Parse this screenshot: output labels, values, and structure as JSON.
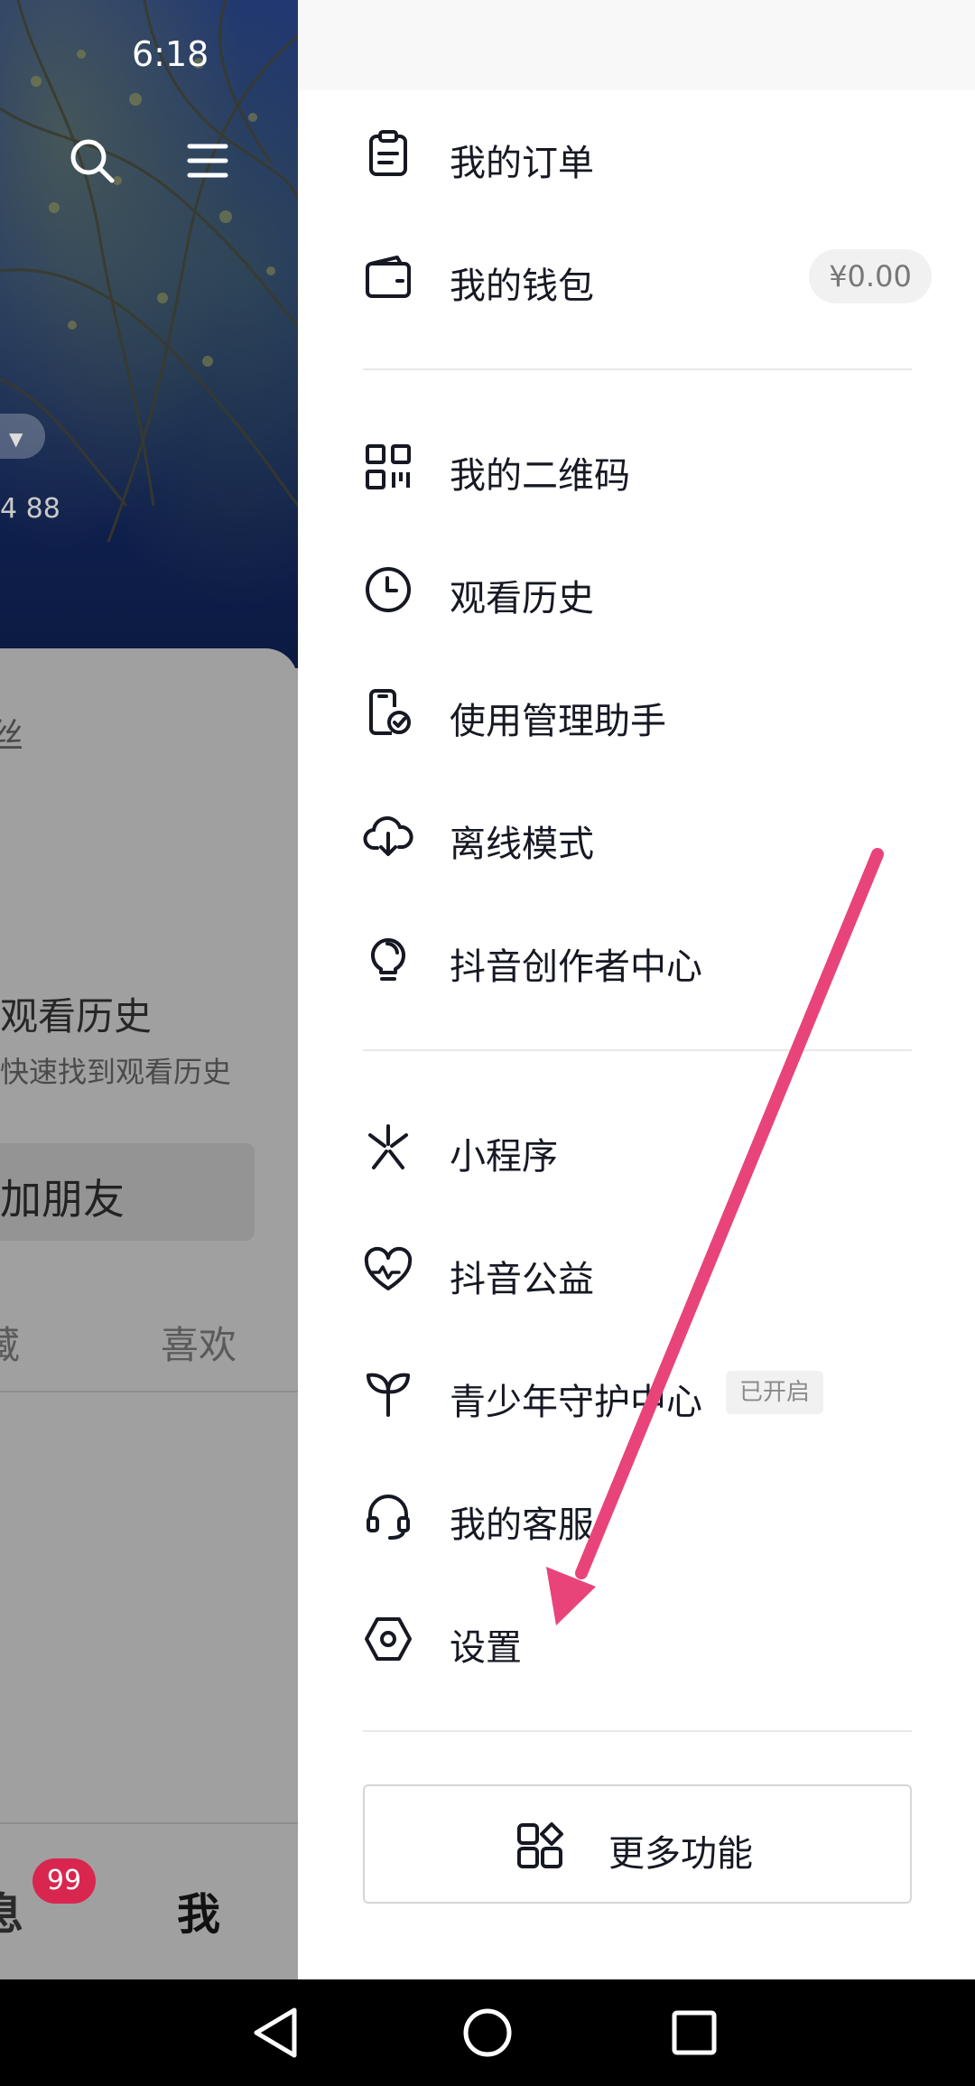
{
  "status_bar": {
    "time": "6:18"
  },
  "profile": {
    "stat_fragment": "4 88",
    "fans_fragment": "丝",
    "history_title": "观看历史",
    "history_subtitle": "快速找到观看历史",
    "add_friend_label": "加朋友",
    "tabs": {
      "collect": "藏",
      "like": "喜欢"
    },
    "bottom_nav": {
      "messages": "息",
      "messages_badge": "99",
      "me": "我"
    }
  },
  "drawer": {
    "menu": [
      {
        "label": "我的订单",
        "icon": "clipboard-icon"
      },
      {
        "label": "我的钱包",
        "icon": "wallet-icon",
        "badge": "¥0.00"
      },
      {
        "label": "我的二维码",
        "icon": "qr-code-icon"
      },
      {
        "label": "观看历史",
        "icon": "clock-icon"
      },
      {
        "label": "使用管理助手",
        "icon": "phone-check-icon"
      },
      {
        "label": "离线模式",
        "icon": "cloud-download-icon"
      },
      {
        "label": "抖音创作者中心",
        "icon": "lightbulb-icon"
      },
      {
        "label": "小程序",
        "icon": "mini-program-icon"
      },
      {
        "label": "抖音公益",
        "icon": "heart-icon"
      },
      {
        "label": "青少年守护中心",
        "icon": "sprout-icon",
        "badge": "已开启"
      },
      {
        "label": "我的客服",
        "icon": "headset-icon"
      },
      {
        "label": "设置",
        "icon": "settings-icon"
      }
    ],
    "more_label": "更多功能"
  },
  "colors": {
    "arrow": "#e8447a",
    "badge_red": "#d9264f"
  }
}
